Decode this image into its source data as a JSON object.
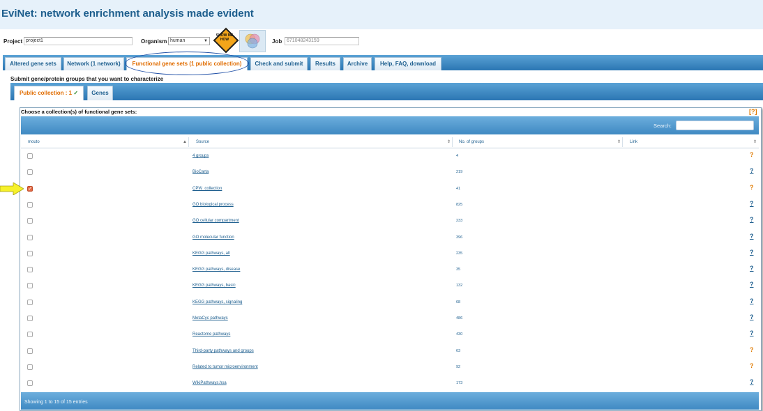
{
  "app": {
    "title": "EviNet: network enrichment analysis made evident"
  },
  "project_row": {
    "project_label": "Project",
    "project_value": "project1",
    "organism_label": "Organism",
    "organism_value": "human",
    "show_me_text": "SHOW ME HOW",
    "job_label": "Job",
    "job_placeholder": "671048243159"
  },
  "tabs": [
    {
      "label": "Altered gene sets"
    },
    {
      "label": "Network (1 network)"
    },
    {
      "label": "Functional gene sets (1 public collection)"
    },
    {
      "label": "Check and submit"
    },
    {
      "label": "Results"
    },
    {
      "label": "Archive"
    },
    {
      "label": "Help, FAQ, download"
    }
  ],
  "submit_label": "Submit gene/protein groups that you want to characterize",
  "subtabs": {
    "public_label": "Public collection : 1",
    "public_check": "✓",
    "genes_label": "Genes"
  },
  "panel": {
    "choose_label": "Choose a collection(s) of functional gene sets:",
    "help_link": "[?]",
    "search_label": "Search:",
    "columns": [
      "mouto",
      "Source",
      "No. of groups",
      "Link"
    ],
    "footer": "Showing 1 to 15 of 15 entries"
  },
  "rows": [
    {
      "source": "4 groups",
      "groups": "4",
      "checked": false,
      "link": "?",
      "link_style": "orange"
    },
    {
      "source": "BioCarta",
      "groups": "219",
      "checked": false,
      "link": "?",
      "link_style": "link"
    },
    {
      "source": "CPW_collection",
      "groups": "41",
      "checked": true,
      "link": "?",
      "link_style": "orange"
    },
    {
      "source": "GO biological process",
      "groups": "825",
      "checked": false,
      "link": "?",
      "link_style": "link"
    },
    {
      "source": "GO cellular compartment",
      "groups": "233",
      "checked": false,
      "link": "?",
      "link_style": "link"
    },
    {
      "source": "GO molecular function",
      "groups": "396",
      "checked": false,
      "link": "?",
      "link_style": "link"
    },
    {
      "source": "KEGG pathways, all",
      "groups": "235",
      "checked": false,
      "link": "?",
      "link_style": "link"
    },
    {
      "source": "KEGG pathways, disease",
      "groups": "35",
      "checked": false,
      "link": "?",
      "link_style": "link"
    },
    {
      "source": "KEGG pathways, basic",
      "groups": "132",
      "checked": false,
      "link": "?",
      "link_style": "link"
    },
    {
      "source": "KEGG pathways, signaling",
      "groups": "68",
      "checked": false,
      "link": "?",
      "link_style": "link"
    },
    {
      "source": "MetaCyc pathways",
      "groups": "486",
      "checked": false,
      "link": "?",
      "link_style": "link"
    },
    {
      "source": "Reactome pathways",
      "groups": "430",
      "checked": false,
      "link": "?",
      "link_style": "link"
    },
    {
      "source": "Third-party pathways and groups",
      "groups": "63",
      "checked": false,
      "link": "?",
      "link_style": "orange"
    },
    {
      "source": "Related to tumor microenvironment",
      "groups": "92",
      "checked": false,
      "link": "?",
      "link_style": "orange"
    },
    {
      "source": "WikiPathways.hsa",
      "groups": "173",
      "checked": false,
      "link": "?",
      "link_style": "link"
    }
  ],
  "colors": {
    "brand": "#1d5e8d",
    "accent": "#e06c00",
    "bar": "#2b76b3",
    "highlight_arrow": "#f6f12a",
    "checked": "#e26a45"
  }
}
